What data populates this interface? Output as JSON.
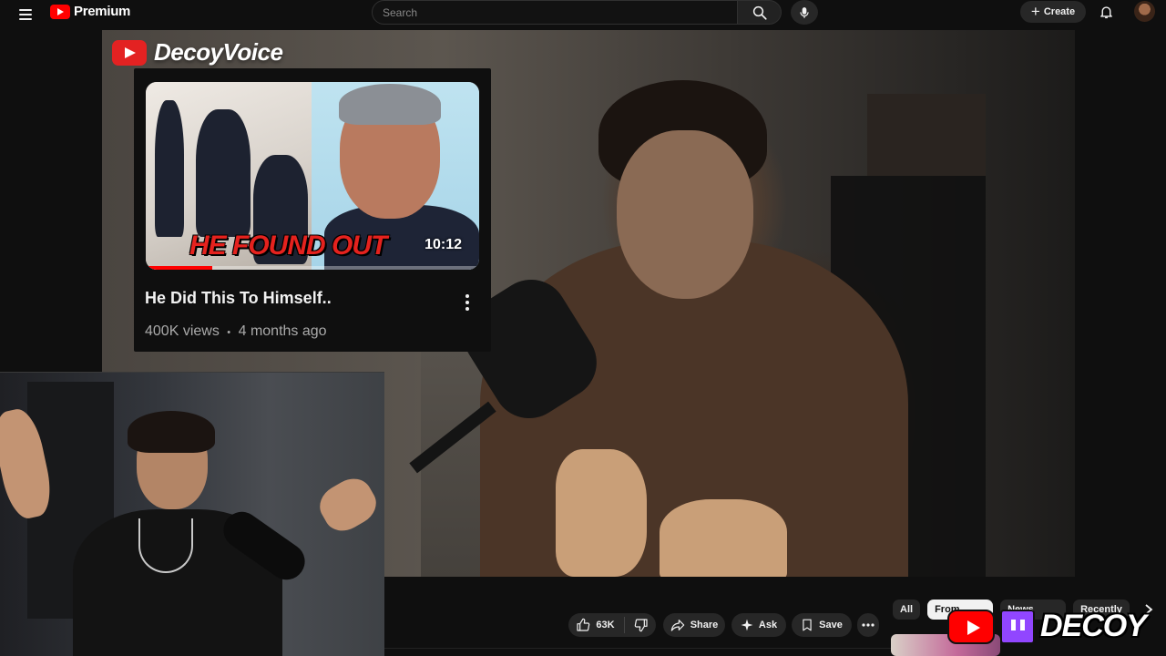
{
  "header": {
    "logo_text": "Premium",
    "search_placeholder": "Search",
    "create_label": "Create"
  },
  "overlay_card": {
    "brand_name": "DecoyVoice",
    "thumbnail_text": "HE FOUND OUT",
    "duration": "10:12",
    "watch_progress": 0.2,
    "title": "He Did This To Himself..",
    "views": "400K views",
    "age": "4 months ago",
    "meta_separator": "•"
  },
  "actions": {
    "like_count": "63K",
    "share_label": "Share",
    "ask_label": "Ask",
    "save_label": "Save"
  },
  "chips": [
    {
      "label": "All",
      "active": false
    },
    {
      "label": "From",
      "active": true
    },
    {
      "label": "News",
      "active": false
    },
    {
      "label": "Recently",
      "active": false
    }
  ],
  "stream_overlay": {
    "name": "DECOY"
  },
  "colors": {
    "brand_red": "#ff0000",
    "twitch_purple": "#9146ff",
    "background": "#0f0f0f"
  },
  "icons": [
    "menu-icon",
    "youtube-logo-icon",
    "search-icon",
    "mic-icon",
    "plus-icon",
    "bell-icon",
    "like-icon",
    "dislike-icon",
    "share-icon",
    "sparkle-icon",
    "save-icon",
    "more-icon",
    "chevron-right-icon",
    "twitch-icon"
  ]
}
